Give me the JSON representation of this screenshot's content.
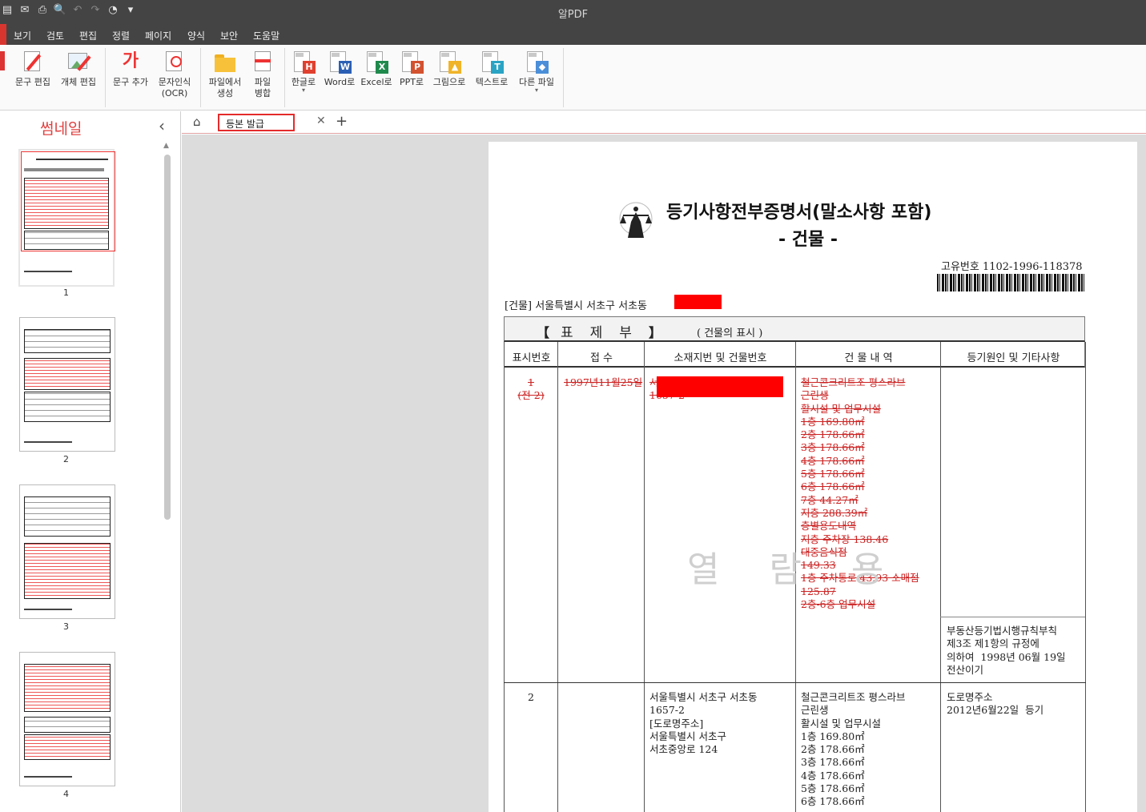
{
  "app": {
    "title": "알PDF"
  },
  "menu": [
    "보기",
    "검토",
    "편집",
    "정렬",
    "페이지",
    "양식",
    "보안",
    "도움말"
  ],
  "ribbon": {
    "text_edit": "문구 편집",
    "object_edit": "개체 편집",
    "add_text": "문구 추가",
    "ocr_line1": "문자인식",
    "ocr_line2": "(OCR)",
    "from_file_line1": "파일에서",
    "from_file_line2": "생성",
    "merge_line1": "파일",
    "merge_line2": "병합",
    "to_hwp": "한글로",
    "to_word": "Word로",
    "to_excel": "Excel로",
    "to_ppt": "PPT로",
    "to_image": "그림으로",
    "to_text": "텍스트로",
    "other_file": "다른 파일",
    "icons": {
      "hwp": "H",
      "word": "W",
      "excel": "X",
      "ppt": "P",
      "image": "▲",
      "text": "T",
      "ocr": "가"
    }
  },
  "thumbnails": {
    "title": "썸네일",
    "pages": [
      "1",
      "2",
      "3",
      "4"
    ]
  },
  "tabs": {
    "active": "등본 발급"
  },
  "document": {
    "title": "등기사항전부증명서(말소사항 포함)",
    "subtitle": "- 건물 -",
    "unique_no": "고유번호 1102-1996-118378",
    "address": "[건물] 서울특별시 서초구 서초동",
    "section_open": "【",
    "section_title": "표제부",
    "section_close": "】",
    "section_sub": "( 건물의 표시 )",
    "headers": [
      "표시번호",
      "접  수",
      "소재지번 및 건물번호",
      "건 물 내 역",
      "등기원인 및 기타사항"
    ],
    "row1": {
      "no": "1\n(전 2)",
      "receipt": "1997년11월25일",
      "location": "서\n1657-2",
      "details": "철근콘크리트조 평스라브\n근린생\n활시설 및 업무시설\n1층 169.80㎡\n2층 178.66㎡\n3층 178.66㎡\n4층 178.66㎡\n5층 178.66㎡\n6층 178.66㎡\n7층 44.27㎡\n지층 288.39㎡\n층별용도내역\n지층 주차장 138.46\n대중음식점\n149.33\n1층 주차통로 43.93 소매점\n125.87\n2층-6층 업무시설",
      "cause": "부동산등기법시행규칙부칙\n제3조 제1항의 규정에\n의하여  1998년 06월 19일\n전산이기"
    },
    "row2": {
      "no": "2",
      "location": "서울특별시 서초구 서초동\n1657-2\n[도로명주소]\n서울특별시 서초구\n서초중앙로 124",
      "details": "철근콘크리트조 평스라브\n근린생\n활시설 및 업무시설\n1층 169.80㎡\n2층 178.66㎡\n3층 178.66㎡\n4층 178.66㎡\n5층 178.66㎡\n6층 178.66㎡",
      "cause": "도로명주소\n2012년6월22일  등기"
    },
    "watermark": "열 람 용"
  }
}
